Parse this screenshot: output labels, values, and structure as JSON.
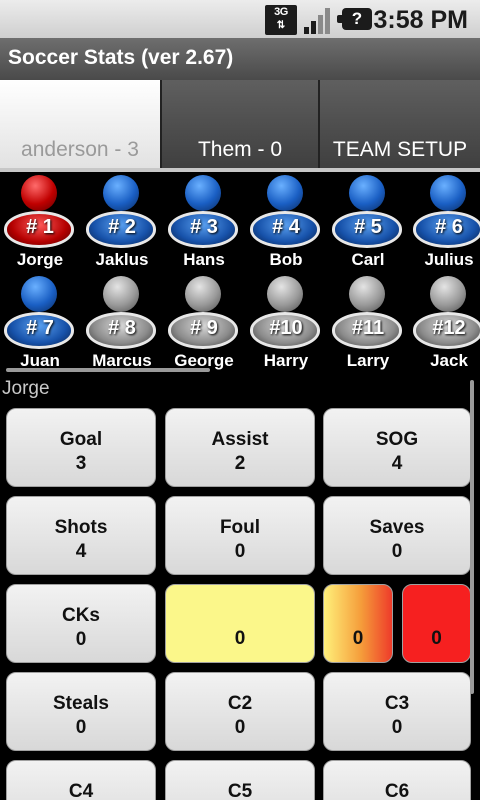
{
  "status_bar": {
    "network_label": "3G",
    "network_arrows": "⇅",
    "battery_glyph": "?",
    "time": "3:58 PM"
  },
  "title_bar": {
    "title": "Soccer Stats (ver 2.67)"
  },
  "tabs": [
    {
      "label": "anderson - 3",
      "active": true
    },
    {
      "label": "Them - 0",
      "active": false
    },
    {
      "label": "TEAM SETUP",
      "active": false
    }
  ],
  "players": [
    {
      "number": "# 1",
      "name": "Jorge",
      "color": "red"
    },
    {
      "number": "# 2",
      "name": "Jaklus",
      "color": "blue"
    },
    {
      "number": "# 3",
      "name": "Hans",
      "color": "blue"
    },
    {
      "number": "# 4",
      "name": "Bob",
      "color": "blue"
    },
    {
      "number": "# 5",
      "name": "Carl",
      "color": "blue"
    },
    {
      "number": "# 6",
      "name": "Julius",
      "color": "blue"
    },
    {
      "number": "# 7",
      "name": "Juan",
      "color": "blue"
    },
    {
      "number": "# 8",
      "name": "Marcus",
      "color": "gray"
    },
    {
      "number": "# 9",
      "name": "George",
      "color": "gray"
    },
    {
      "number": "#10",
      "name": "Harry",
      "color": "gray"
    },
    {
      "number": "#11",
      "name": "Larry",
      "color": "gray"
    },
    {
      "number": "#12",
      "name": "Jack",
      "color": "gray"
    }
  ],
  "selected_player": "Jorge",
  "stats": [
    {
      "label": "Goal",
      "value": "3"
    },
    {
      "label": "Assist",
      "value": "2"
    },
    {
      "label": "SOG",
      "value": "4"
    },
    {
      "label": "Shots",
      "value": "4"
    },
    {
      "label": "Foul",
      "value": "0"
    },
    {
      "label": "Saves",
      "value": "0"
    },
    {
      "label": "CKs",
      "value": "0"
    },
    {
      "label": "",
      "value": "0",
      "card": "yellow"
    },
    {
      "label": "",
      "value": "0",
      "card": "orange"
    },
    {
      "label": "",
      "value": "0",
      "card": "red"
    },
    {
      "label": "Steals",
      "value": "0"
    },
    {
      "label": "C2",
      "value": "0"
    },
    {
      "label": "C3",
      "value": "0"
    },
    {
      "label": "C4",
      "value": ""
    },
    {
      "label": "C5",
      "value": ""
    },
    {
      "label": "C6",
      "value": ""
    }
  ],
  "colors": {
    "player_red": "#c00000",
    "player_blue": "#1a5fc4",
    "player_gray": "#9a9a9a",
    "yellow_card": "#fbf78a",
    "red_card": "#f62020"
  }
}
